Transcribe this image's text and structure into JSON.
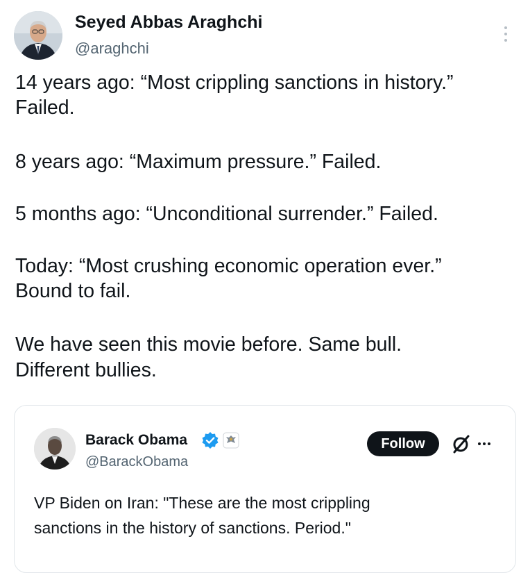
{
  "tweet": {
    "author_name": "Seyed Abbas Araghchi",
    "author_handle": "@araghchi",
    "lines": [
      "14 years ago: “Most crippling sanctions in history.”",
      "Failed.",
      "8 years ago: “Maximum pressure.” Failed.",
      "5 months ago: “Unconditional surrender.” Failed.",
      "Today: “Most crushing economic operation ever.”",
      "Bound to fail.",
      "We have seen this movie before. Same bull.",
      "Different bullies."
    ]
  },
  "quoted_tweet": {
    "author_name": "Barack Obama",
    "author_handle": "@BarackObama",
    "follow_label": "Follow",
    "text_lines": [
      "VP Biden on Iran: \"These are the most crippling",
      "sanctions in the history of sanctions. Period.\""
    ]
  },
  "icons": {
    "more": "more-vertical-icon",
    "verified": "verified-badge-icon",
    "seal": "government-seal-icon",
    "grok": "grok-icon",
    "quote_more": "more-horizontal-icon"
  },
  "colors": {
    "text": "#0f1419",
    "secondary_text": "#536471",
    "verified_blue": "#1d9bf0",
    "follow_bg": "#0f1419"
  }
}
